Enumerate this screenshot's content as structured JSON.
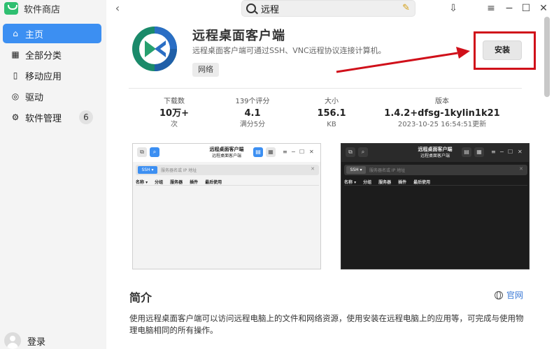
{
  "sidebar": {
    "app_name": "软件商店",
    "items": [
      {
        "label": "主页",
        "active": true
      },
      {
        "label": "全部分类"
      },
      {
        "label": "移动应用"
      },
      {
        "label": "驱动"
      },
      {
        "label": "软件管理",
        "badge": "6"
      }
    ],
    "login_label": "登录"
  },
  "search": {
    "value": "远程"
  },
  "app": {
    "name": "远程桌面客户端",
    "description": "远程桌面客户端可通过SSH、VNC远程协议连接计算机。",
    "tag": "网络",
    "install_label": "安装"
  },
  "stats": [
    {
      "label": "下载数",
      "value": "10万+",
      "unit": "次"
    },
    {
      "label": "139个评分",
      "value": "4.1",
      "unit": "满分5分"
    },
    {
      "label": "大小",
      "value": "156.1",
      "unit": "KB"
    },
    {
      "label": "版本",
      "value": "1.4.2+dfsg-1kylin1k21",
      "unit": "2023-10-25 16:54:51更新"
    }
  ],
  "screenshots": [
    {
      "theme": "light",
      "title": "远程桌面客户端",
      "subtitle": "远程桌面客户端",
      "protocol": "SSH ▾",
      "search_placeholder": "服务器名或 IP 地址",
      "columns": [
        "名称 ▾",
        "分组",
        "服务器",
        "插件",
        "最后使用"
      ]
    },
    {
      "theme": "dark",
      "title": "远程桌面客户端",
      "subtitle": "远程桌面客户端",
      "protocol": "SSH ▾",
      "search_placeholder": "服务器名或 IP 地址",
      "columns": [
        "名称 ▾",
        "分组",
        "服务器",
        "插件",
        "最后使用"
      ]
    }
  ],
  "intro": {
    "title": "简介",
    "website_label": "官网",
    "text": "使用远程桌面客户端可以访问远程电脑上的文件和网络资源，使用安装在远程电脑上的应用等，可完成与使用物理电脑相同的所有操作。"
  },
  "colors": {
    "accent": "#3c8ff2",
    "annotation": "#d0101a"
  }
}
